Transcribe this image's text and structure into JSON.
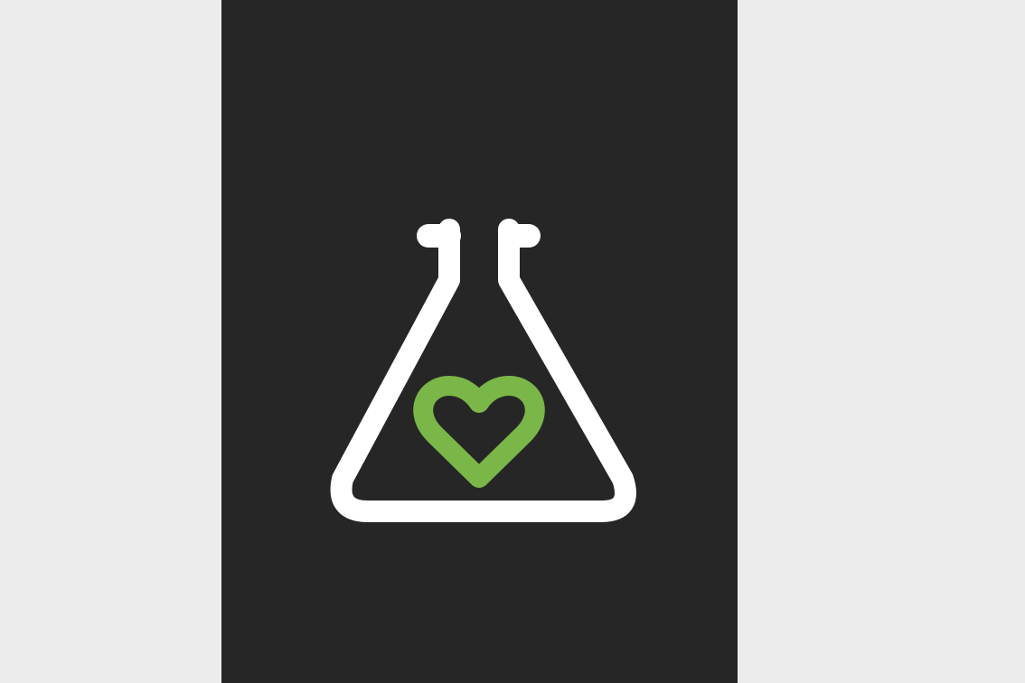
{
  "colors": {
    "page_background": "#ececec",
    "panel_background": "#262626",
    "flask_stroke": "#ffffff",
    "heart_stroke": "#7ab648"
  },
  "icons": {
    "logo": "flask-with-heart-icon",
    "flask": "flask-icon",
    "heart": "heart-icon"
  }
}
